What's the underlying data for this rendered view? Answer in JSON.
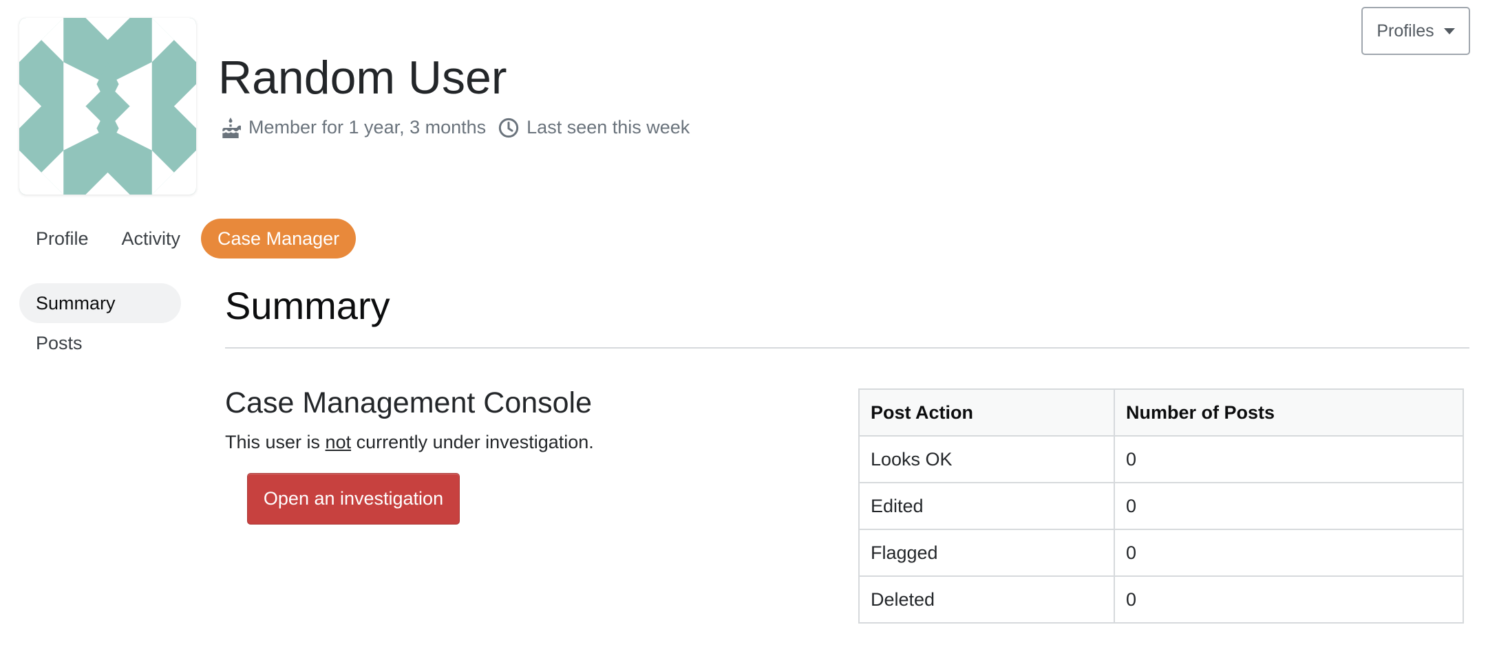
{
  "user": {
    "name": "Random User",
    "member_for": "Member for 1 year, 3 months",
    "last_seen": "Last seen this week"
  },
  "profiles_menu": {
    "label": "Profiles"
  },
  "tabs": [
    {
      "label": "Profile",
      "active": false
    },
    {
      "label": "Activity",
      "active": false
    },
    {
      "label": "Case Manager",
      "active": true
    }
  ],
  "subnav": [
    {
      "label": "Summary",
      "active": true
    },
    {
      "label": "Posts",
      "active": false
    }
  ],
  "main": {
    "title": "Summary",
    "console": {
      "title": "Case Management Console",
      "status_before": "This user is ",
      "status_neg": "not",
      "status_after": " currently under investigation.",
      "open_button": "Open an investigation"
    },
    "table": {
      "headers": [
        "Post Action",
        "Number of Posts"
      ],
      "rows": [
        [
          "Looks OK",
          "0"
        ],
        [
          "Edited",
          "0"
        ],
        [
          "Flagged",
          "0"
        ],
        [
          "Deleted",
          "0"
        ]
      ]
    }
  },
  "colors": {
    "accent": "#e8893b",
    "danger": "#c7413f",
    "avatar": "#91c4bb"
  },
  "icons": {
    "member": "cake-icon",
    "last_seen": "clock-icon",
    "profiles": "caret-down-icon"
  }
}
